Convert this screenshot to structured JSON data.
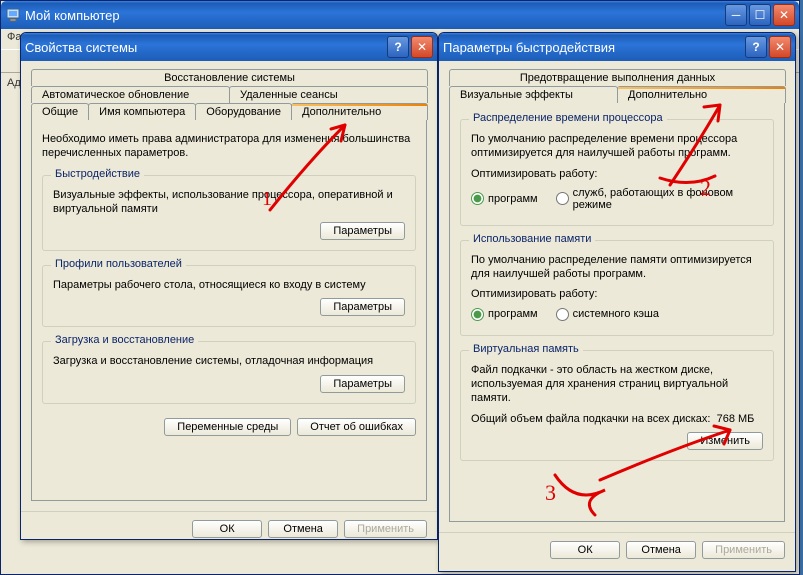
{
  "explorer": {
    "title": "Мой компьютер",
    "menu_file": "Фа",
    "addr_label": "Адр"
  },
  "sysprops": {
    "title": "Свойства системы",
    "tabs": {
      "restore": "Восстановление системы",
      "autoupdate": "Автоматическое обновление",
      "remote": "Удаленные сеансы",
      "general": "Общие",
      "computername": "Имя компьютера",
      "hardware": "Оборудование",
      "advanced": "Дополнительно"
    },
    "advanced_intro": "Необходимо иметь права админиcтратора для изменения большинства перечисленных параметров.",
    "perf": {
      "legend": "Быстродействие",
      "text": "Визуальные эффекты, использование процессора, оперативной и виртуальной памяти",
      "button": "Параметры"
    },
    "profiles": {
      "legend": "Профили пользователей",
      "text": "Параметры рабочего стола, относящиеся ко входу в систему",
      "button": "Параметры"
    },
    "startup": {
      "legend": "Загрузка и восстановление",
      "text": "Загрузка и восстановление системы, отладочная информация",
      "button": "Параметры"
    },
    "envvars": "Переменные среды",
    "errreport": "Отчет об ошибках",
    "ok": "ОК",
    "cancel": "Отмена",
    "apply": "Применить"
  },
  "perfopts": {
    "title": "Параметры быстродействия",
    "tabs": {
      "dep": "Предотвращение выполнения данных",
      "visual": "Визуальные эффекты",
      "advanced": "Дополнительно"
    },
    "cpu": {
      "legend": "Распределение времени процессора",
      "text": "По умолчанию распределение времени процессора оптимизируется для наилучшей работы программ.",
      "optimize": "Оптимизировать работу:",
      "programs": "программ",
      "services": "служб, работающих в фоновом режиме"
    },
    "mem": {
      "legend": "Использование памяти",
      "text": "По умолчанию распределение памяти оптимизируется для наилучшей работы программ.",
      "optimize": "Оптимизировать работу:",
      "programs": "программ",
      "cache": "системного кэша"
    },
    "vmem": {
      "legend": "Виртуальная память",
      "text": "Файл подкачки - это область на жестком диске, используемая для хранения страниц виртуальной памяти.",
      "total_label": "Общий объем файла подкачки на всех дисках:",
      "total_value": "768 МБ",
      "change": "Изменить"
    },
    "ok": "ОК",
    "cancel": "Отмена",
    "apply": "Применить"
  }
}
